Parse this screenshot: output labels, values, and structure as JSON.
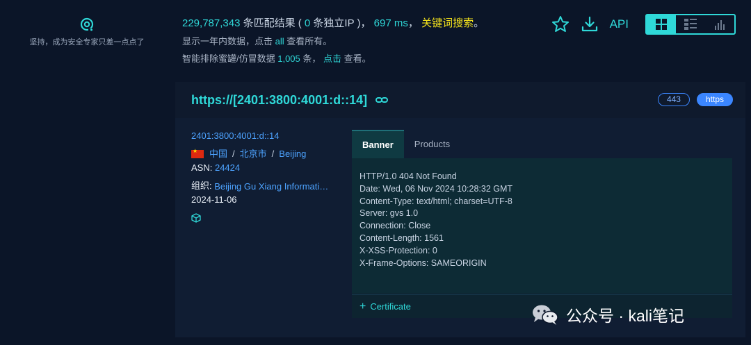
{
  "sidebar": {
    "slogan": "坚持，成为安全专家只差一点点了"
  },
  "summary": {
    "result_count": "229,787,343",
    "results_text": " 条匹配结果 ( ",
    "ip_count": "0",
    "ip_text": " 条独立IP )，",
    "time_value": "697 ms",
    "comma": "，",
    "keyword_search": "关键词搜索",
    "period": "。",
    "year_prefix": "显示一年内数据，点击 ",
    "all_link": "all",
    "year_suffix": " 查看所有。",
    "honeypot_prefix": "智能排除蜜罐/仿冒数据 ",
    "honeypot_count": "1,005",
    "honeypot_unit": " 条，",
    "click_link": "点击",
    "honeypot_suffix": " 查看。"
  },
  "toolbar": {
    "star": "star-icon",
    "download": "download-icon",
    "api_label": "API",
    "views": [
      "grid-view",
      "list-view",
      "stats-view"
    ],
    "active_view": "grid-view",
    "accent": "#2fd8d8"
  },
  "result": {
    "title": "https://[2401:3800:4001:d::14]",
    "port": "443",
    "protocol": "https",
    "ip": "2401:3800:4001:d::14",
    "country": "中国",
    "province": "北京市",
    "city": "Beijing",
    "sep": "/",
    "asn_label": "ASN:",
    "asn": "24424",
    "org_label": "组织:",
    "org": "Beijing Gu Xiang Information Technology Co. Ltd.",
    "date": "2024-11-06"
  },
  "tabs": [
    {
      "label": "Banner",
      "active": true
    },
    {
      "label": "Products",
      "active": false
    }
  ],
  "banner_lines": [
    "HTTP/1.0 404 Not Found",
    "Date: Wed, 06 Nov 2024 10:28:32 GMT",
    "Content-Type: text/html; charset=UTF-8",
    "Server: gvs 1.0",
    "Connection: Close",
    "Content-Length: 1561",
    "X-XSS-Protection: 0",
    "X-Frame-Options: SAMEORIGIN"
  ],
  "certificate": {
    "plus": "+",
    "label": "Certificate"
  },
  "watermark": {
    "text": "公众号 · kali笔记"
  }
}
